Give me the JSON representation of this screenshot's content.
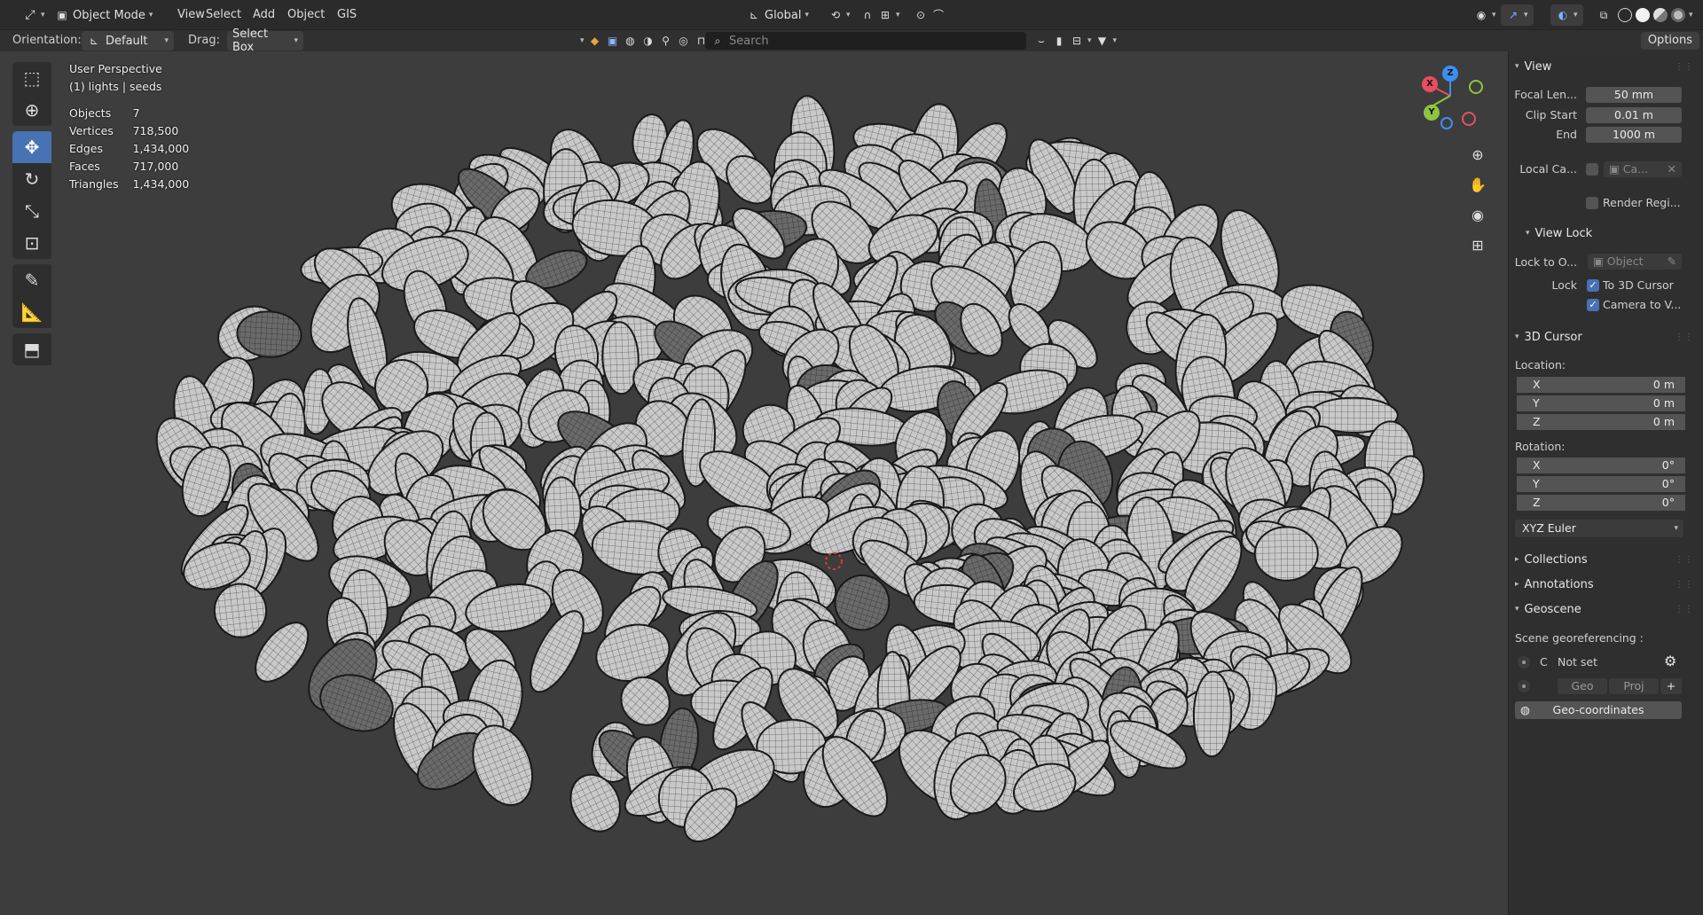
{
  "header": {
    "mode": "Object Mode",
    "menus": [
      "View",
      "Select",
      "Add",
      "Object",
      "GIS"
    ],
    "transform_orientation": "Global"
  },
  "tool_settings": {
    "orientation_label": "Orientation:",
    "orientation_value": "Default",
    "drag_label": "Drag:",
    "drag_value": "Select Box",
    "search_placeholder": "Search",
    "options_label": "Options"
  },
  "viewport": {
    "perspective": "User Perspective",
    "context": "(1) lights | seeds",
    "stats": [
      {
        "label": "Objects",
        "value": "7"
      },
      {
        "label": "Vertices",
        "value": "718,500"
      },
      {
        "label": "Edges",
        "value": "1,434,000"
      },
      {
        "label": "Faces",
        "value": "717,000"
      },
      {
        "label": "Triangles",
        "value": "1,434,000"
      }
    ],
    "gizmo_axes": [
      "X",
      "Z",
      "Y"
    ]
  },
  "npanel": {
    "view": {
      "title": "View",
      "focal_label": "Focal Len...",
      "focal_value": "50 mm",
      "clip_start_label": "Clip Start",
      "clip_start_value": "0.01 m",
      "end_label": "End",
      "end_value": "1000 m",
      "local_camera_label": "Local Ca...",
      "local_camera_value": "Ca...",
      "render_region_label": "Render Regi..."
    },
    "view_lock": {
      "title": "View Lock",
      "lock_to_object_label": "Lock to O...",
      "lock_to_object_value": "Object",
      "lock_label": "Lock",
      "to_3d_cursor": "To 3D Cursor",
      "camera_to_view": "Camera to V..."
    },
    "cursor": {
      "title": "3D Cursor",
      "location_label": "Location:",
      "location": [
        {
          "axis": "X",
          "value": "0 m"
        },
        {
          "axis": "Y",
          "value": "0 m"
        },
        {
          "axis": "Z",
          "value": "0 m"
        }
      ],
      "rotation_label": "Rotation:",
      "rotation": [
        {
          "axis": "X",
          "value": "0°"
        },
        {
          "axis": "Y",
          "value": "0°"
        },
        {
          "axis": "Z",
          "value": "0°"
        }
      ],
      "rotation_mode": "XYZ Euler"
    },
    "collections": "Collections",
    "annotations": "Annotations",
    "geoscene": {
      "title": "Geoscene",
      "georef_label": "Scene georeferencing :",
      "crs_letter": "C",
      "crs_value": "Not set",
      "geo_label": "Geo",
      "proj_label": "Proj",
      "geo_coords_label": "Geo-coordinates"
    }
  },
  "colors": {
    "accent": "#4772b3",
    "axis_x": "#e84d62",
    "axis_y": "#8cc63f",
    "axis_z": "#3c8ff0"
  }
}
